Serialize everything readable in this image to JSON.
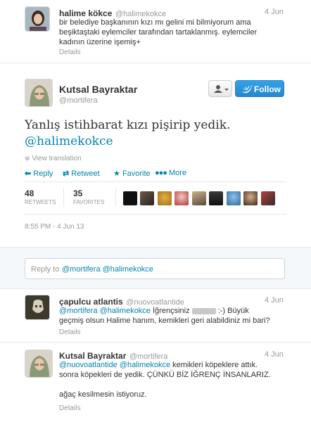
{
  "tweet1": {
    "name": "halime kökce",
    "handle": "@halimekokce",
    "date": "4 Jun",
    "line1": "bir belediye başkanının kızı mı gelini mi bilmiyorum ama",
    "line2": "beşiktaştaki eylemciler tarafından tartaklanmış. eylemciler",
    "line3": "kadının üzerine işemiş+",
    "details": "Details"
  },
  "main": {
    "name": "Kutsal Bayraktar",
    "handle": "@mortifera",
    "text": "Yanlış istihbarat kızı pişirip yedik.",
    "mention": "@halimekokce",
    "view_translation": "View translation",
    "actions": {
      "reply": "Reply",
      "retweet": "Retweet",
      "favorite": "Favorite",
      "more": "More"
    },
    "stats": {
      "retweets_count": "48",
      "retweets_label": "RETWEETS",
      "favorites_count": "35",
      "favorites_label": "FAVORITES"
    },
    "timestamp": "8:55 PM - 4 Jun 13",
    "follow_label": "Follow",
    "colors": {
      "accent": "#0084b4",
      "follow_button": "#2e9ce0",
      "stat_number": "#333333"
    }
  },
  "reply_box": {
    "prefix": "Reply to",
    "mentions": "@mortifera @halimekokce"
  },
  "reply1": {
    "name": "çapulcu atlantis",
    "handle": "@nuovoatlantide",
    "date": "4 Jun",
    "mentions": "@mortifera @halimekokce",
    "line1_rest": "İğrençsiniz",
    "line1_end": ":-) Büyük",
    "line2": "geçmiş olsun Halime hanım, kemikleri geri alabildiniz mi bari?",
    "details": "Details"
  },
  "reply2": {
    "name": "Kutsal Bayraktar",
    "handle": "@mortifera",
    "date": "4 Jun",
    "mentions": "@nuovoatlantide @halimekokce",
    "line1_rest": "kemikleri köpeklere attık.",
    "line2": "sonra köpekleri de yedik. ÇÜNKÜ BİZ İĞRENÇ İNSANLARIZ.",
    "line3": "ağaç kesilmesin istiyoruz.",
    "details": "Details"
  }
}
